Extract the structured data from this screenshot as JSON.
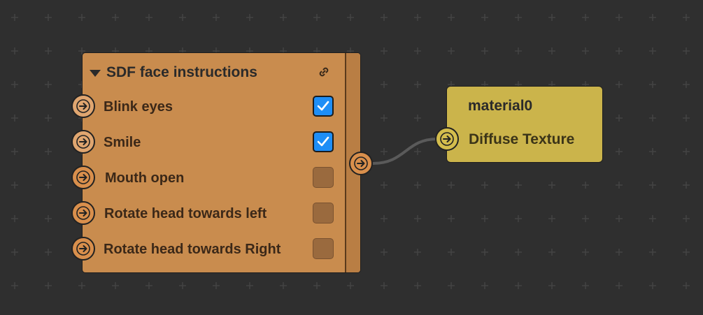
{
  "sdf_node": {
    "title": "SDF face instructions",
    "header_icons": {
      "collapse": "triangle-down-icon",
      "link": "link-icon"
    },
    "rows": [
      {
        "label": "Blink eyes",
        "checked": true
      },
      {
        "label": "Smile",
        "checked": true
      },
      {
        "label": "Mouth open",
        "checked": false
      },
      {
        "label": "Rotate head towards left",
        "checked": false
      },
      {
        "label": "Rotate head towards Right",
        "checked": false
      }
    ],
    "output_port_icon": "arrow-right-icon"
  },
  "material_node": {
    "title": "material0",
    "input": {
      "label": "Diffuse Texture",
      "icon": "arrow-right-icon"
    }
  },
  "colors": {
    "canvas": "#2f2f2f",
    "grid_cross": "#444444",
    "sdf_node": "#c98c4e",
    "material_node": "#cbb44b",
    "checkbox_on": "#1e8ef6",
    "wire": "#5a5a5a"
  }
}
